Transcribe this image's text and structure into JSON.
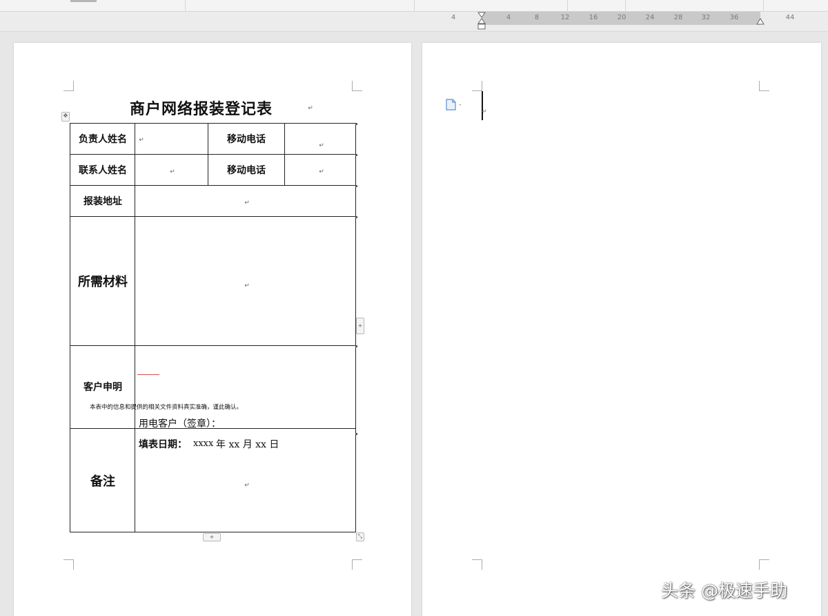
{
  "ruler": {
    "ticks": [
      "4",
      "4",
      "8",
      "12",
      "16",
      "20",
      "24",
      "28",
      "32",
      "36",
      "44"
    ]
  },
  "form": {
    "title": "商户网络报装登记表",
    "rows": {
      "person_in_charge_label": "负责人姓名",
      "mobile_label_1": "移动电话",
      "contact_label": "联系人姓名",
      "mobile_label_2": "移动电话",
      "address_label": "报装地址",
      "materials_label": "所需材料",
      "declaration_label": "客户申明",
      "remarks_label": "备注"
    },
    "declaration": {
      "statement": "本表中的信息和提供的相关文件资料真实准确，谨此确认。",
      "signature_line": "用电客户（签章）：",
      "date_prefix": "填表日期：",
      "date_year": "xxxx",
      "date_rest": "年 xx 月 xx 日"
    }
  },
  "watermark": {
    "text": "头条 @极速手助"
  },
  "colors": {
    "workspace": "#e7e7e7",
    "page": "#ffffff",
    "spell_underline": "#d05050"
  }
}
